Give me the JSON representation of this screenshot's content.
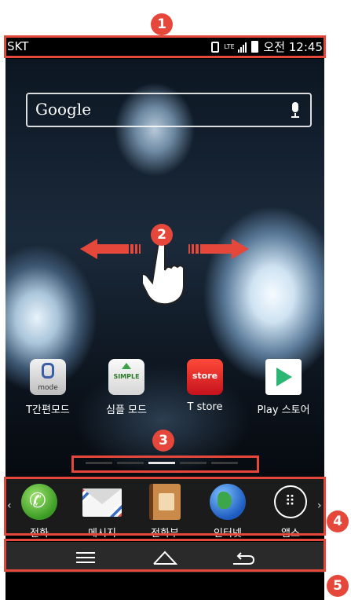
{
  "status_bar": {
    "carrier": "SKT",
    "network": "LTE",
    "time": "오전 12:45"
  },
  "search": {
    "logo": "Google",
    "mic_icon": "mic-icon"
  },
  "home_apps": [
    {
      "label": "T간편모드",
      "tile_text": "mode",
      "icon": "t-mode-icon"
    },
    {
      "label": "심플 모드",
      "tile_text": "SIMPLE",
      "icon": "simple-mode-icon"
    },
    {
      "label": "T store",
      "tile_text": "store",
      "icon": "t-store-icon"
    },
    {
      "label": "Play 스토어",
      "tile_text": "",
      "icon": "play-store-icon"
    }
  ],
  "page_indicator": {
    "pages": 5,
    "current": 3
  },
  "dock": [
    {
      "label": "전화",
      "icon": "phone-icon"
    },
    {
      "label": "메시지",
      "icon": "message-icon"
    },
    {
      "label": "전화부",
      "icon": "contacts-icon"
    },
    {
      "label": "인터넷",
      "icon": "globe-icon"
    },
    {
      "label": "앱스",
      "icon": "apps-grid-icon"
    }
  ],
  "nav_bar": [
    "menu-icon",
    "home-icon",
    "back-icon"
  ],
  "annotations": [
    "1",
    "2",
    "3",
    "4",
    "5"
  ],
  "colors": {
    "annotation": "#e5483b",
    "dock": "#1e1e1e"
  }
}
